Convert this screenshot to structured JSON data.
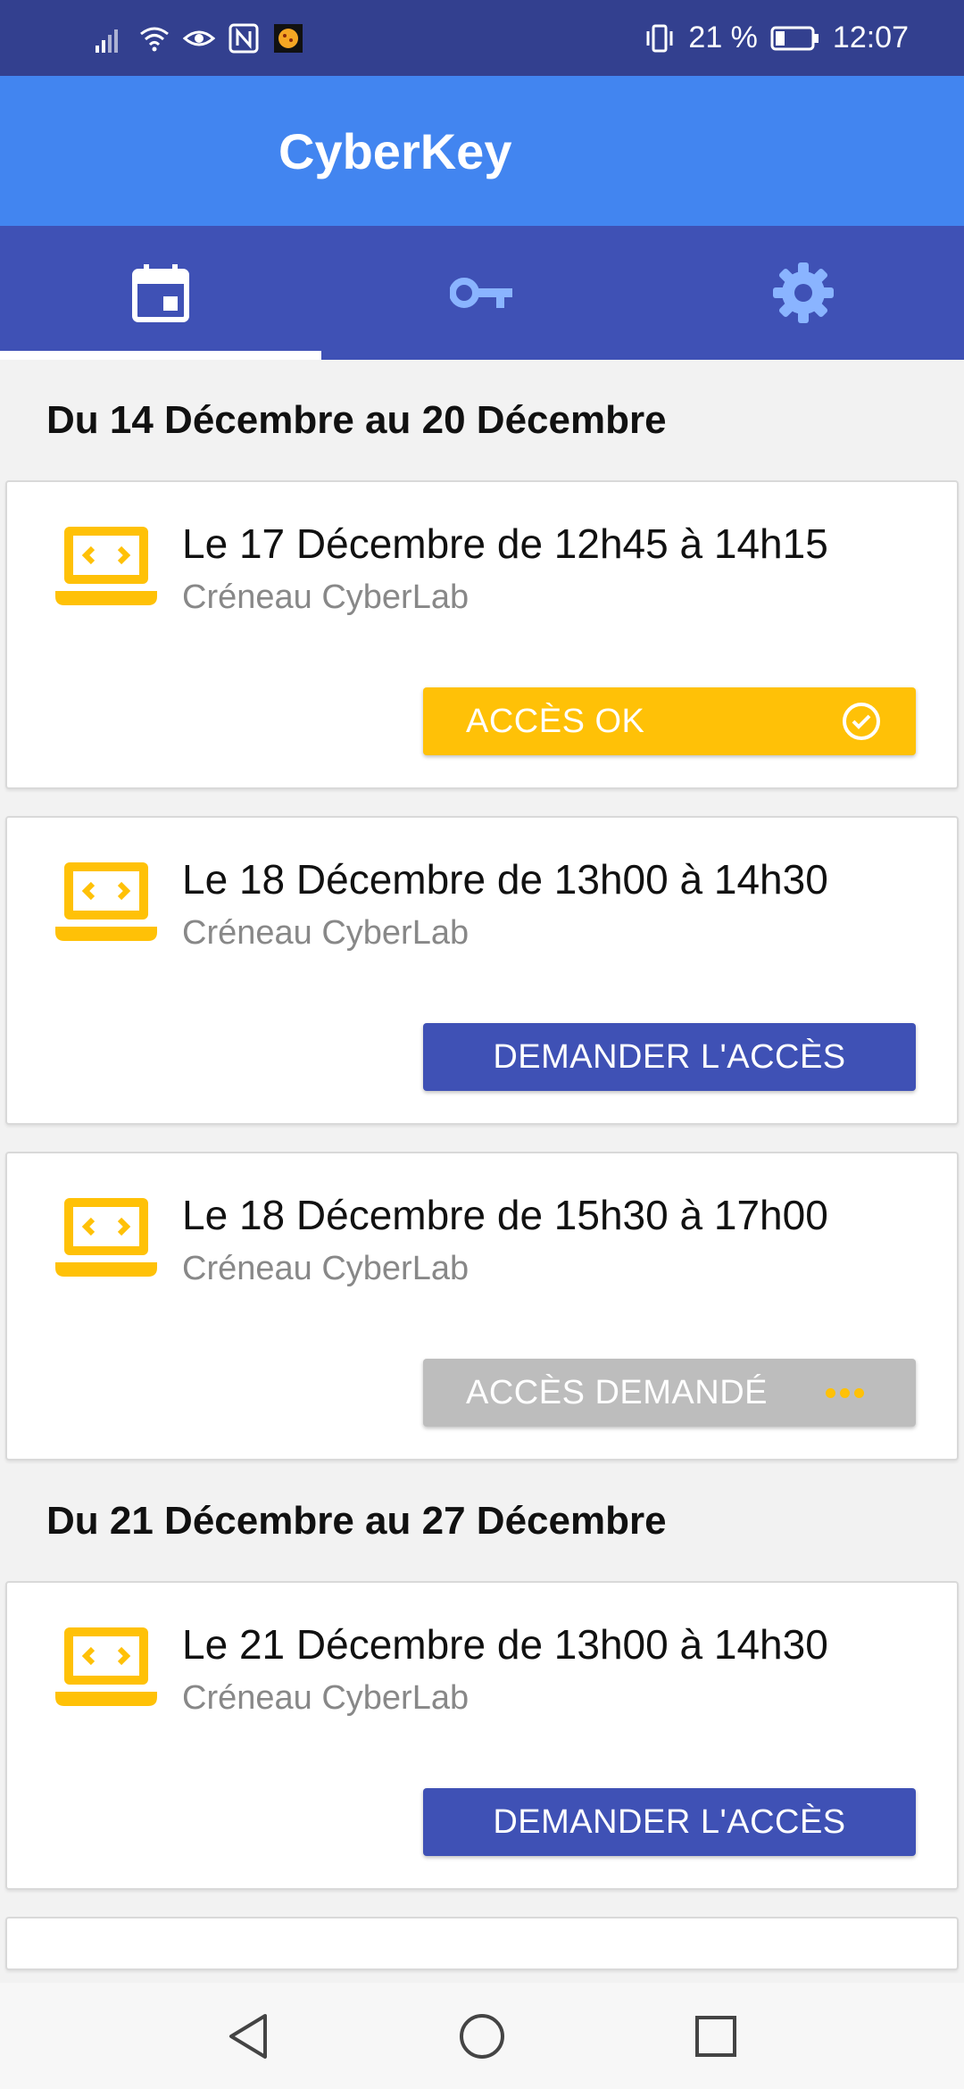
{
  "status_bar": {
    "battery_text": "21 %",
    "time": "12:07"
  },
  "app_bar": {
    "title": "CyberKey"
  },
  "tabs": [
    {
      "icon": "calendar-icon",
      "active": true
    },
    {
      "icon": "key-icon",
      "active": false
    },
    {
      "icon": "gear-icon",
      "active": false
    }
  ],
  "weeks": [
    {
      "header": "Du 14 Décembre au 20 Décembre",
      "slots": [
        {
          "title": "Le 17 Décembre de 12h45 à 14h15",
          "subtitle": "Créneau CyberLab",
          "button": "ACCÈS OK",
          "status": "ok"
        },
        {
          "title": "Le 18 Décembre de 13h00 à 14h30",
          "subtitle": "Créneau CyberLab",
          "button": "DEMANDER L'ACCÈS",
          "status": "request"
        },
        {
          "title": "Le 18 Décembre de 15h30 à 17h00",
          "subtitle": "Créneau CyberLab",
          "button": "ACCÈS DEMANDÉ",
          "status": "pending"
        }
      ]
    },
    {
      "header": "Du 21 Décembre au 27 Décembre",
      "slots": [
        {
          "title": "Le 21 Décembre de 13h00 à 14h30",
          "subtitle": "Créneau CyberLab",
          "button": "DEMANDER L'ACCÈS",
          "status": "request"
        }
      ]
    }
  ],
  "colors": {
    "status_bar": "#33408f",
    "app_bar": "#4285f0",
    "tabs": "#3f51b5",
    "accent_yellow": "#ffc107",
    "button_blue": "#3f51b5",
    "button_grey": "#bdbdbd"
  }
}
